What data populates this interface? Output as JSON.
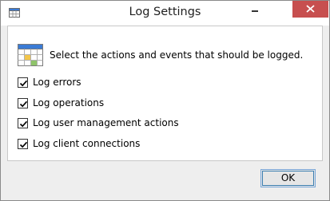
{
  "window": {
    "title": "Log Settings",
    "minimize_glyph": "—",
    "close_glyph": "✕"
  },
  "header": {
    "instruction": "Select the actions and events that should be logged."
  },
  "options": [
    {
      "label": "Log errors",
      "checked": true
    },
    {
      "label": "Log operations",
      "checked": true
    },
    {
      "label": "Log user management actions",
      "checked": true
    },
    {
      "label": "Log client connections",
      "checked": true
    }
  ],
  "footer": {
    "ok_label": "OK"
  },
  "colors": {
    "close_button": "#c74f4f",
    "icon_blue": "#3a7bd5",
    "ok_border": "#3c7fb1"
  },
  "icons": {
    "app": "log-settings-app-icon",
    "header": "calendar-grid-icon",
    "check": "checkmark-icon"
  }
}
